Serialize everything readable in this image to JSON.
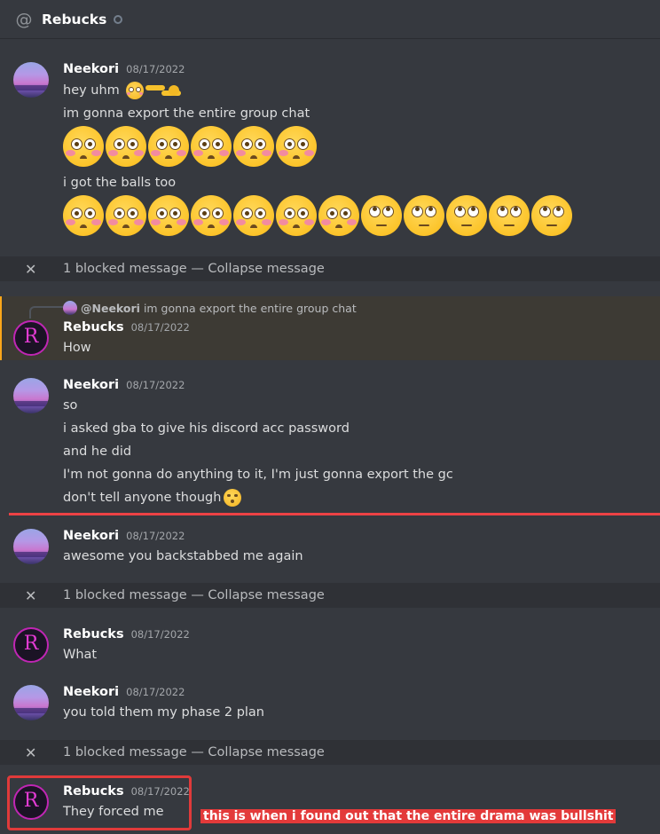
{
  "header": {
    "icon": "at-icon",
    "title": "Rebucks"
  },
  "messages": {
    "m1": {
      "author": "Neekori",
      "timestamp": "08/17/2022",
      "lines": [
        "hey uhm",
        "im gonna export the entire group chat",
        "i got the balls too"
      ]
    },
    "blocked": {
      "count_text": "1 blocked message",
      "separator": "—",
      "action": "Collapse message"
    },
    "reply": {
      "ref_author": "@Neekori",
      "ref_text": "im gonna export the entire group chat",
      "author": "Rebucks",
      "timestamp": "08/17/2022",
      "text": "How"
    },
    "m3": {
      "author": "Neekori",
      "timestamp": "08/17/2022",
      "lines": [
        "so",
        "i asked gba to give his discord acc password",
        "and he did",
        "I'm not gonna do anything to it, I'm just gonna export the gc",
        "don't tell anyone though"
      ]
    },
    "m4": {
      "author": "Neekori",
      "timestamp": "08/17/2022",
      "text": "awesome you backstabbed me again"
    },
    "m5": {
      "author": "Rebucks",
      "timestamp": "08/17/2022",
      "text": "What"
    },
    "m6": {
      "author": "Neekori",
      "timestamp": "08/17/2022",
      "text": "you told them my phase 2 plan"
    },
    "m7": {
      "author": "Rebucks",
      "timestamp": "08/17/2022",
      "text": "They forced me"
    }
  },
  "annotation": {
    "text": "this is when i found out that the entire drama was bullshit"
  },
  "colors": {
    "background": "#36393f",
    "blocked_bg": "#2f3136",
    "reply_highlight": "#faa61a",
    "annotation": "#e33a3a"
  },
  "avatar_letter": "R"
}
